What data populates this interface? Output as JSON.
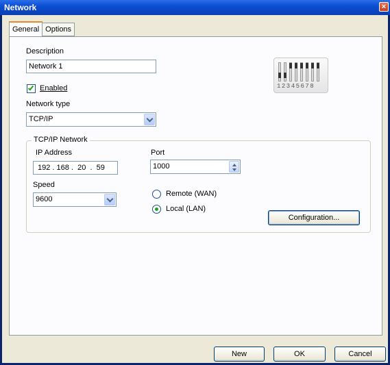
{
  "window": {
    "title": "Network"
  },
  "tabs": [
    {
      "label": "General",
      "active": true
    },
    {
      "label": "Options",
      "active": false
    }
  ],
  "general": {
    "description_label": "Description",
    "description_value": "Network 1",
    "enabled_label": "Enabled",
    "enabled_checked": true,
    "network_type_label": "Network type",
    "network_type_value": "TCP/IP",
    "dip_switch_numbers": "12345678"
  },
  "tcpip_group": {
    "title": "TCP/IP Network",
    "ip_address_label": "IP Address",
    "ip_address_value": "192 . 168 .  20  .  59",
    "port_label": "Port",
    "port_value": "1000",
    "speed_label": "Speed",
    "speed_value": "9600",
    "remote_label": "Remote (WAN)",
    "local_label": "Local (LAN)",
    "selected_mode": "Local (LAN)",
    "configuration_button": "Configuration..."
  },
  "footer": {
    "new_label": "New",
    "ok_label": "OK",
    "cancel_label": "Cancel"
  },
  "colors": {
    "title_bar": "#0b4ed4",
    "dialog_bg": "#ece9d8",
    "panel_bg": "#fcfcfe",
    "check_green": "#21a121"
  }
}
